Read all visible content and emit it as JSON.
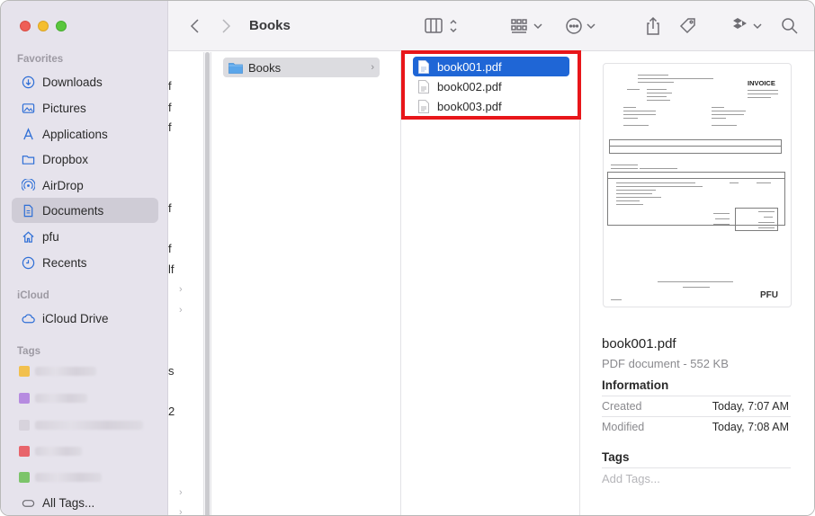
{
  "sidebar": {
    "favorites_header": "Favorites",
    "favorites": [
      {
        "label": "Downloads",
        "icon": "download-icon"
      },
      {
        "label": "Pictures",
        "icon": "pictures-icon"
      },
      {
        "label": "Applications",
        "icon": "applications-icon"
      },
      {
        "label": "Dropbox",
        "icon": "folder-icon"
      },
      {
        "label": "AirDrop",
        "icon": "airdrop-icon"
      },
      {
        "label": "Documents",
        "icon": "document-icon",
        "selected": true
      },
      {
        "label": "pfu",
        "icon": "home-icon"
      },
      {
        "label": "Recents",
        "icon": "clock-icon"
      }
    ],
    "icloud_header": "iCloud",
    "icloud_drive": "iCloud Drive",
    "tags_header": "Tags",
    "tag_colors": [
      "#f2c04e",
      "#b68be0",
      "#d7d3dc",
      "#e8646b",
      "#7cc46a"
    ],
    "all_tags": "All Tags..."
  },
  "toolbar": {
    "title": "Books"
  },
  "column0": {
    "fragments": [
      "f",
      "f",
      "f",
      "f",
      "f",
      "lf",
      "s",
      "2"
    ]
  },
  "column1": {
    "folder": "Books"
  },
  "column2": {
    "files": [
      "book001.pdf",
      "book002.pdf",
      "book003.pdf"
    ]
  },
  "preview": {
    "document_heading": "INVOICE",
    "document_logo": "PFU",
    "name": "book001.pdf",
    "type": "PDF document - 552 KB",
    "information_header": "Information",
    "created_label": "Created",
    "created_value": "Today, 7:07 AM",
    "modified_label": "Modified",
    "modified_value": "Today, 7:08 AM",
    "tags_header": "Tags",
    "add_tags": "Add Tags..."
  },
  "colors": {
    "selection": "#1f66d6",
    "highlight": "#e8161a",
    "sidebar_bg": "#e6e3ec"
  }
}
